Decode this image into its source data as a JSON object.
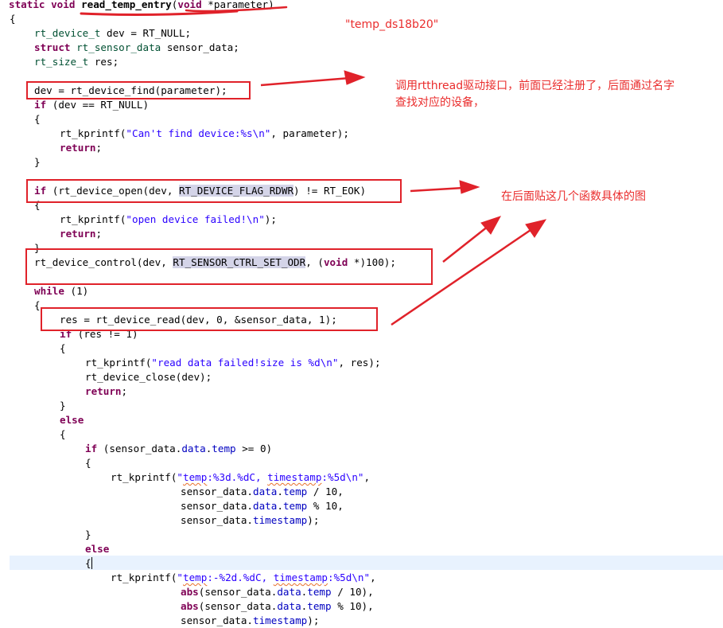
{
  "code": {
    "l1_static": "static",
    "l1_void": "void",
    "l1_name": "read_temp_entry",
    "l1_void2": "void",
    "l1_param": " *parameter)",
    "brace_open": "{",
    "brace_close": "}",
    "t_device": "rt_device_t",
    "l2_rest": " dev = RT_NULL;",
    "k_struct": "struct",
    "t_sensor": "rt_sensor_data",
    "l3_rest": " sensor_data;",
    "t_size": "rt_size_t",
    "l4_rest": " res;",
    "find_call": "dev = rt_device_find(parameter);",
    "k_if": "if",
    "if_null_rest": " (dev == RT_NULL)",
    "kprintf": "rt_kprintf(",
    "str_cant_find": "\"Can't find device:%s\\n\"",
    "cant_find_tail": ", parameter);",
    "k_return": "return",
    "semicolon": ";",
    "open_pre": " (rt_device_open(dev, ",
    "flag_rdwr": "RT_DEVICE_FLAG_RDWR",
    "open_post": ") != RT_EOK)",
    "str_open_failed": "\"open device failed!\\n\"",
    "close_paren_semi": ");",
    "ctrl_pre": "rt_device_control(dev, ",
    "ctrl_odr": "RT_SENSOR_CTRL_SET_ODR",
    "ctrl_mid": ", (",
    "k_void": "void",
    "ctrl_post": " *)100);",
    "k_while": "while",
    "while_rest": " (1)",
    "read_call": "res = rt_device_read(dev, 0, &sensor_data, 1);",
    "if_res_rest": " (res != 1)",
    "str_read_failed": "\"read data failed!size is %d\\n\"",
    "read_failed_tail": ", res);",
    "close_call": "rt_device_close(dev);",
    "k_else": "else",
    "sd_prefix": "sensor_data.",
    "f_data": "data",
    "dot": ".",
    "f_temp": "temp",
    "f_timestamp": "timestamp",
    "ge_zero": " >= 0)",
    "if_paren_open": " (",
    "str_temp_pos_a": "\"",
    "str_temp_pos_word": "temp",
    "str_temp_pos_b": ":%3d.%dC, ",
    "str_timestamp_word": "timestamp",
    "str_ts_tail": ":%5d\\n\"",
    "comma": ",",
    "div10": " / 10,",
    "mod10": " % 10,",
    "close_tail": ");",
    "str_temp_neg_b": ":-%2d.%dC, ",
    "k_abs": "abs",
    "abs_open": "(sensor_data.",
    "div10_paren": " / 10),",
    "mod10_paren": " % 10),",
    "last_partial": "}"
  },
  "annotations": {
    "device_name": "\"temp_ds18b20\"",
    "find_note_line1": "调用rtthread驱动接口，前面已经注册了，后面通过名字",
    "find_note_line2": "查找对应的设备，",
    "functions_note": "在后面贴这几个函数具体的图"
  },
  "colors": {
    "annotation_red": "#e0222a",
    "keyword": "#7f0055",
    "type": "#005032",
    "string": "#2a00ff",
    "field": "#0000c0",
    "caret_line": "#e8f2fe",
    "highlight": "#d4d4e8"
  }
}
